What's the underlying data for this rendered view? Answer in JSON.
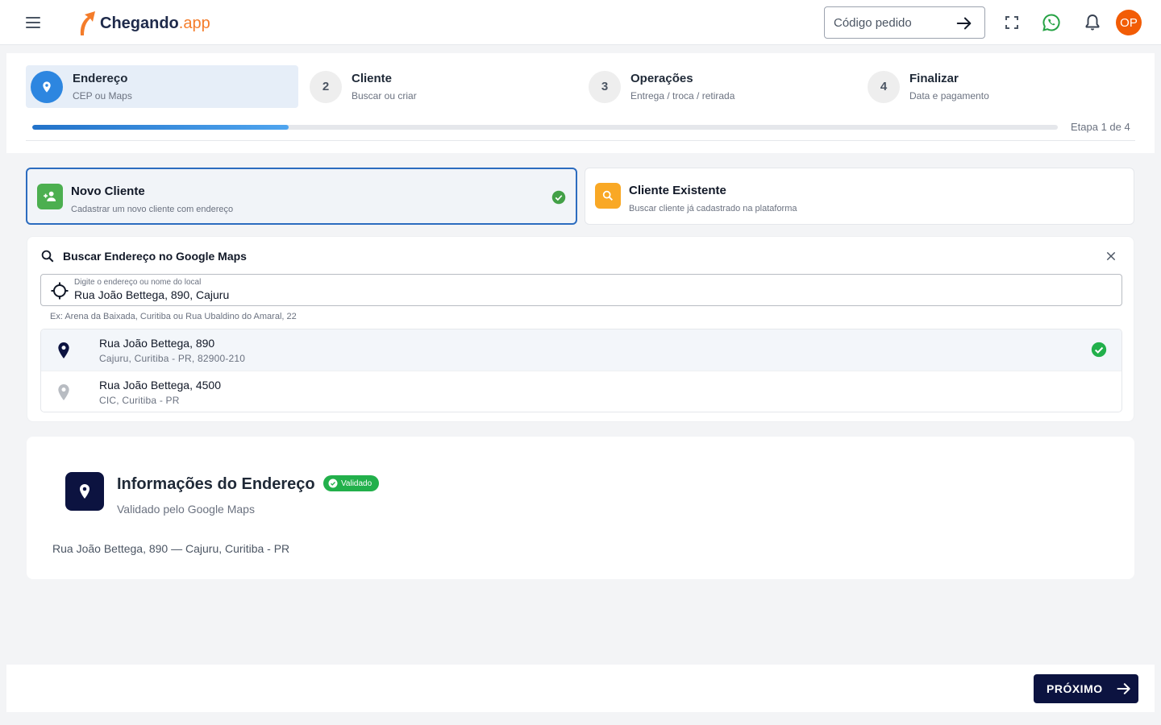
{
  "header": {
    "logo_brand": "Chegando",
    "logo_suffix": ".app",
    "order_placeholder": "Código pedido",
    "avatar_initials": "OP",
    "icons": [
      "menu-icon",
      "arrow-right-icon",
      "fullscreen-icon",
      "whatsapp-icon",
      "bell-icon"
    ],
    "accent_color": "#f25c05"
  },
  "stepper": {
    "steps": [
      {
        "number": "1",
        "title": "Endereço",
        "subtitle": "CEP ou Maps",
        "active": true
      },
      {
        "number": "2",
        "title": "Cliente",
        "subtitle": "Buscar ou criar",
        "active": false
      },
      {
        "number": "3",
        "title": "Operações",
        "subtitle": "Entrega / troca / retirada",
        "active": false
      },
      {
        "number": "4",
        "title": "Finalizar",
        "subtitle": "Data e pagamento",
        "active": false
      }
    ],
    "progress_fraction": 0.25,
    "progress_label": "Etapa 1 de 4"
  },
  "client_type": {
    "new": {
      "title": "Novo Cliente",
      "subtitle": "Cadastrar um novo cliente com endereço",
      "selected": true,
      "icon": "person-add-icon"
    },
    "existing": {
      "title": "Cliente Existente",
      "subtitle": "Buscar cliente já cadastrado na plataforma",
      "selected": false,
      "icon": "search-icon"
    }
  },
  "search": {
    "title": "Buscar Endereço no Google Maps",
    "field_label": "Digite o endereço ou nome do local",
    "field_value": "Rua João Bettega, 890, Cajuru",
    "hint": "Ex: Arena da Baixada, Curitiba ou Rua Ubaldino do Amaral, 22",
    "results": [
      {
        "title": "Rua João Bettega, 890",
        "subtitle": "Cajuru, Curitiba - PR, 82900-210",
        "selected": true
      },
      {
        "title": "Rua João Bettega, 4500",
        "subtitle": "CIC, Curitiba - PR",
        "selected": false
      }
    ]
  },
  "address_info": {
    "title": "Informações do Endereço",
    "badge": "Validado",
    "subtitle": "Validado pelo Google Maps",
    "address_line": "Rua João Bettega, 890 — Cajuru, Curitiba - PR"
  },
  "footer": {
    "next_label": "PRÓXIMO"
  },
  "colors": {
    "primary_dark": "#0c1340",
    "step_active": "#2d86e0",
    "success": "#22b04b",
    "warning": "#f9a825"
  }
}
